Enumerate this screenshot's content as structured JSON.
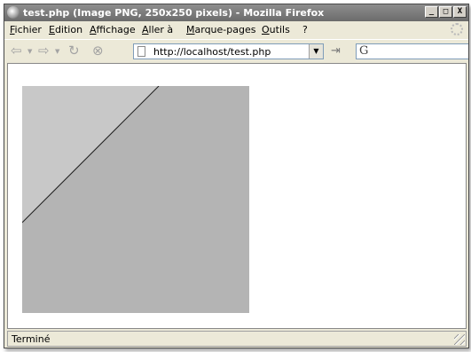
{
  "window": {
    "title": "test.php (Image PNG, 250x250 pixels) - Mozilla Firefox",
    "controls": {
      "minimize": "_",
      "maximize": "□",
      "close": "X"
    }
  },
  "menu": {
    "items": [
      "Fichier",
      "Edition",
      "Affichage",
      "Aller à",
      "Marque-pages",
      "Outils",
      "?"
    ]
  },
  "navigation": {
    "url": "http://localhost/test.php",
    "icons": [
      "back-icon",
      "forward-icon",
      "reload-icon",
      "stop-icon",
      "page-icon",
      "go-icon",
      "search-engine-icon"
    ]
  },
  "content": {
    "image_size": "250x250",
    "colors": {
      "upper_triangle": "#c8c8c8",
      "lower_area": "#b4b4b4",
      "diagonal_line": "#1e1e1e"
    }
  },
  "status": {
    "text": "Terminé"
  }
}
